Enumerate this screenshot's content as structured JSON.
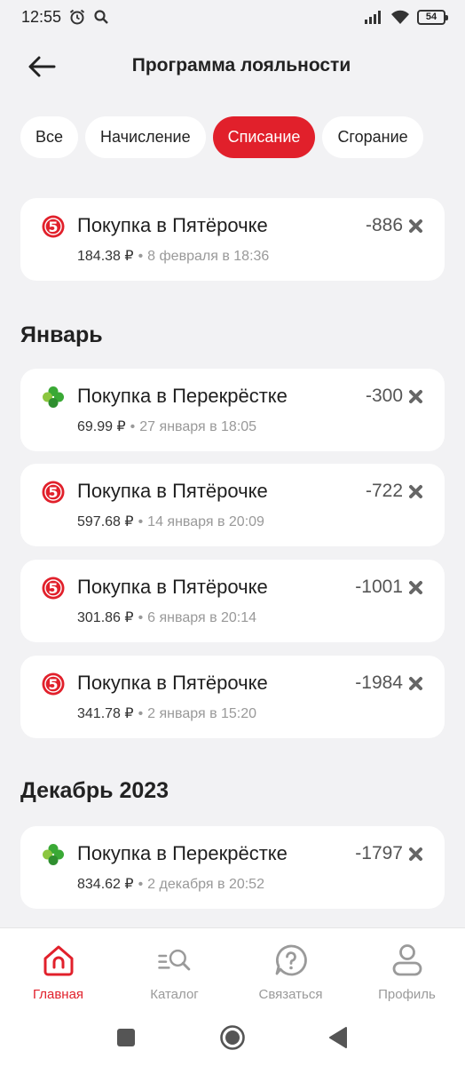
{
  "status": {
    "time": "12:55",
    "battery": "54"
  },
  "header": {
    "title": "Программа лояльности"
  },
  "tabs": [
    {
      "label": "Все",
      "active": false
    },
    {
      "label": "Начисление",
      "active": false
    },
    {
      "label": "Списание",
      "active": true
    },
    {
      "label": "Сгорание",
      "active": false
    }
  ],
  "sections": [
    {
      "title": "",
      "transactions": [
        {
          "store": "pyaterochka",
          "title": "Покупка в Пятёрочке",
          "amount": "184.38 ₽",
          "date": "8 февраля в 18:36",
          "points": "-886"
        }
      ]
    },
    {
      "title": "Январь",
      "transactions": [
        {
          "store": "perekrestok",
          "title": "Покупка в Перекрёстке",
          "amount": "69.99 ₽",
          "date": "27 января в 18:05",
          "points": "-300"
        },
        {
          "store": "pyaterochka",
          "title": "Покупка в Пятёрочке",
          "amount": "597.68 ₽",
          "date": "14 января в 20:09",
          "points": "-722"
        },
        {
          "store": "pyaterochka",
          "title": "Покупка в Пятёрочке",
          "amount": "301.86 ₽",
          "date": "6 января в 20:14",
          "points": "-1001"
        },
        {
          "store": "pyaterochka",
          "title": "Покупка в Пятёрочке",
          "amount": "341.78 ₽",
          "date": "2 января в 15:20",
          "points": "-1984"
        }
      ]
    },
    {
      "title": "Декабрь 2023",
      "transactions": [
        {
          "store": "perekrestok",
          "title": "Покупка в Перекрёстке",
          "amount": "834.62 ₽",
          "date": "2 декабря в 20:52",
          "points": "-1797"
        }
      ]
    }
  ],
  "bottom_nav": [
    {
      "label": "Главная",
      "icon": "home-icon",
      "active": true
    },
    {
      "label": "Каталог",
      "icon": "catalog-search-icon",
      "active": false
    },
    {
      "label": "Связаться",
      "icon": "help-chat-icon",
      "active": false
    },
    {
      "label": "Профиль",
      "icon": "profile-icon",
      "active": false
    }
  ],
  "colors": {
    "accent": "#e1202b",
    "pyaterochka": "#e1202b",
    "perekrestok": "#3aa935",
    "background": "#f2f2f4"
  }
}
